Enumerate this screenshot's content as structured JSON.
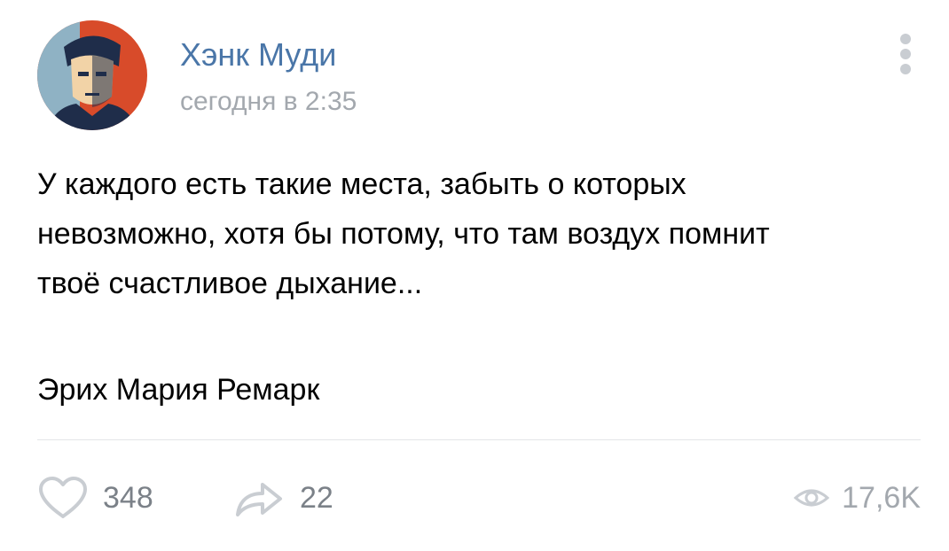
{
  "post": {
    "author": {
      "name": "Хэнк Муди",
      "avatar_icon": "user-avatar-portrait",
      "avatar_colors": [
        "#d84b2a",
        "#1f2d4a",
        "#8fb2c4",
        "#f2d3a7"
      ]
    },
    "date": "сегодня в 2:35",
    "text": "У каждого есть такие места, забыть о которых\nневозможно, хотя бы потому, что там воздух помнит\nтвоё счастливое дыхание...",
    "quote_author": "Эрих Мария Ремарк",
    "actions": {
      "likes": {
        "icon": "heart-icon",
        "count": "348"
      },
      "shares": {
        "icon": "share-arrow-icon",
        "count": "22"
      },
      "views": {
        "icon": "eye-icon",
        "count": "17,6K"
      }
    },
    "menu_icon": "more-vertical-icon"
  },
  "colors": {
    "accent": "#4a76a8",
    "muted_text": "#a3a8ae",
    "icon": "#c9cdd2",
    "action_text": "#7b8188"
  }
}
